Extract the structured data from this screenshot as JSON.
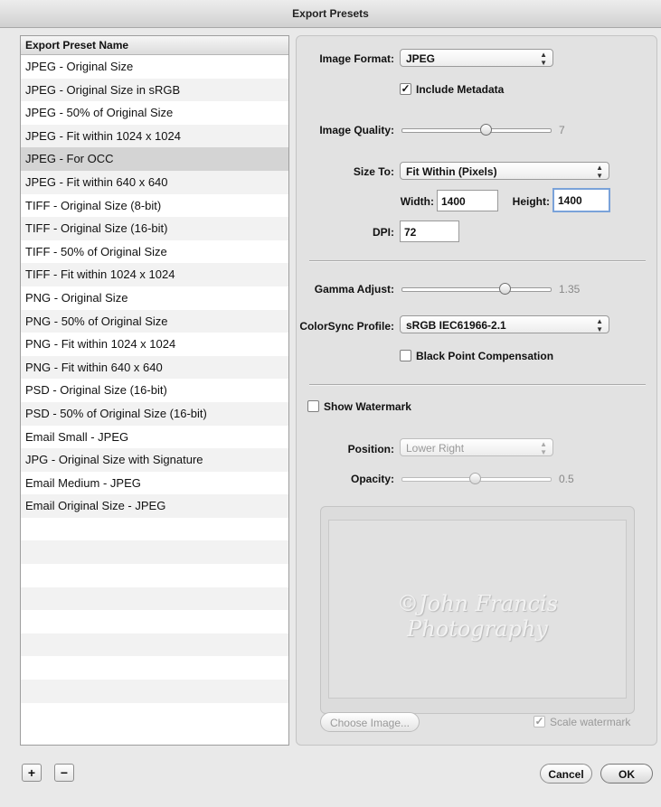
{
  "window": {
    "title": "Export Presets"
  },
  "preset_list": {
    "header": "Export Preset Name",
    "selected_index": 4,
    "items": [
      "JPEG - Original Size",
      "JPEG - Original Size in sRGB",
      "JPEG - 50% of Original Size",
      "JPEG - Fit within 1024 x 1024",
      "JPEG - For OCC",
      "JPEG - Fit within 640 x 640",
      "TIFF - Original Size (8-bit)",
      "TIFF - Original Size (16-bit)",
      "TIFF - 50% of Original Size",
      "TIFF - Fit within 1024 x 1024",
      "PNG - Original Size",
      "PNG - 50% of Original Size",
      "PNG - Fit within 1024 x 1024",
      "PNG - Fit within 640 x 640",
      "PSD - Original Size (16-bit)",
      "PSD - 50% of Original Size (16-bit)",
      "Email Small - JPEG",
      "JPG - Original Size with Signature",
      "Email Medium - JPEG",
      "Email Original Size - JPEG"
    ]
  },
  "settings": {
    "image_format_label": "Image Format:",
    "image_format_value": "JPEG",
    "include_metadata_label": "Include Metadata",
    "include_metadata_checked": true,
    "image_quality_label": "Image Quality:",
    "image_quality_value": "7",
    "size_to_label": "Size To:",
    "size_to_value": "Fit Within (Pixels)",
    "width_label": "Width:",
    "width_value": "1400",
    "height_label": "Height:",
    "height_value": "1400",
    "dpi_label": "DPI:",
    "dpi_value": "72",
    "gamma_label": "Gamma Adjust:",
    "gamma_value": "1.35",
    "colorsync_label": "ColorSync Profile:",
    "colorsync_value": "sRGB IEC61966-2.1",
    "black_point_label": "Black Point Compensation",
    "black_point_checked": false,
    "show_watermark_label": "Show Watermark",
    "show_watermark_checked": false,
    "position_label": "Position:",
    "position_value": "Lower Right",
    "opacity_label": "Opacity:",
    "opacity_value": "0.5",
    "watermark_preview_text": "©John Francis Photography",
    "choose_image_label": "Choose Image...",
    "scale_watermark_label": "Scale watermark",
    "scale_watermark_checked": true
  },
  "footer": {
    "add_label": "+",
    "remove_label": "−",
    "cancel_label": "Cancel",
    "ok_label": "OK"
  },
  "icons": {
    "popup_arrows": "updown-chevron-icon",
    "checkmark": "checkmark-icon"
  }
}
